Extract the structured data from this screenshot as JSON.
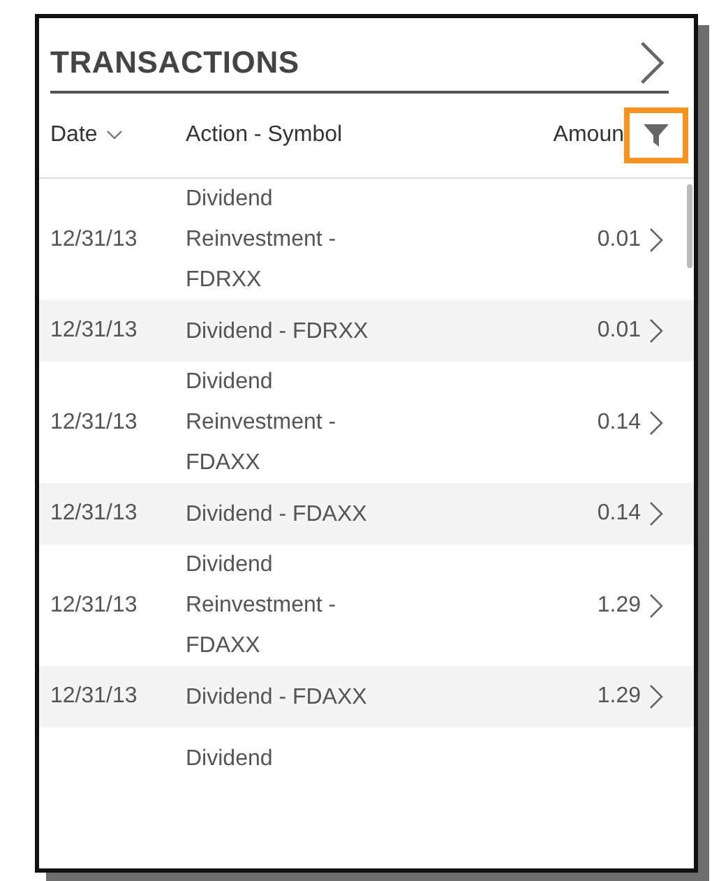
{
  "panel": {
    "title": "TRANSACTIONS"
  },
  "columns": [
    {
      "label": "Date",
      "sortable": true
    },
    {
      "label": "Action - Symbol",
      "sortable": false
    },
    {
      "label": "Amoun",
      "sortable": false
    }
  ],
  "rows": [
    {
      "date": "12/31/13",
      "action": "Dividend Reinvestment - FDRXX",
      "amount": "0.01"
    },
    {
      "date": "12/31/13",
      "action": "Dividend - FDRXX",
      "amount": "0.01"
    },
    {
      "date": "12/31/13",
      "action": "Dividend Reinvestment - FDAXX",
      "amount": "0.14"
    },
    {
      "date": "12/31/13",
      "action": "Dividend - FDAXX",
      "amount": "0.14"
    },
    {
      "date": "12/31/13",
      "action": "Dividend Reinvestment - FDAXX",
      "amount": "1.29"
    },
    {
      "date": "12/31/13",
      "action": "Dividend - FDAXX",
      "amount": "1.29"
    },
    {
      "action": "Dividend"
    }
  ]
}
